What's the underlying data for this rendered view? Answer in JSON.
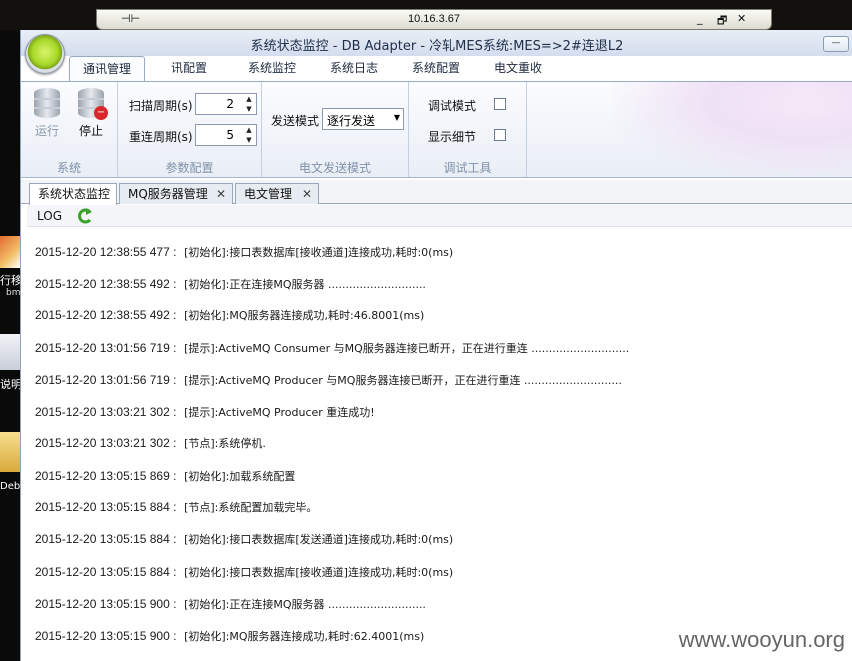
{
  "rdp": {
    "ip": "10.16.3.67",
    "pin_glyph": "⊣⊢",
    "minimize_glyph": "_",
    "restore_glyph": "🗗",
    "close_glyph": "✕"
  },
  "desktop": {
    "icon1_label": "行移",
    "icon1_sub": "bm",
    "icon2_label": "说明.",
    "icon3_label": "Deb"
  },
  "window": {
    "title": "系统状态监控 - DB Adapter - 冷轧MES系统:MES=>2#连退L2",
    "minimize_glyph": "—"
  },
  "ribbon_tabs": [
    "通讯管理",
    "讯配置",
    "系统监控",
    "系统日志",
    "系统配置",
    "电文重收"
  ],
  "ribbon": {
    "system": {
      "run_label": "运行",
      "stop_label": "停止",
      "group_label": "系统"
    },
    "params": {
      "scan_label": "扫描周期(s)",
      "scan_value": "2",
      "reconnect_label": "重连周期(s)",
      "reconnect_value": "5",
      "group_label": "参数配置"
    },
    "send": {
      "mode_label": "发送模式",
      "mode_value": "逐行发送",
      "group_label": "电文发送模式"
    },
    "debug": {
      "debug_mode_label": "调试模式",
      "show_detail_label": "显示细节",
      "group_label": "调试工具"
    }
  },
  "doc_tabs": [
    {
      "label": "系统状态监控"
    },
    {
      "label": "MQ服务器管理",
      "close": "✕"
    },
    {
      "label": "电文管理",
      "close": "✕"
    }
  ],
  "log": {
    "toolbar_label": "LOG",
    "lines": [
      {
        "ts": "2015-12-20 12:38:55 477 :",
        "msg": "[初始化]:接口表数据库[接收通道]连接成功,耗时:0(ms)"
      },
      {
        "ts": "2015-12-20 12:38:55 492 :",
        "msg": "[初始化]:正在连接MQ服务器 ............................"
      },
      {
        "ts": "2015-12-20 12:38:55 492 :",
        "msg": "[初始化]:MQ服务器连接成功,耗时:46.8001(ms)"
      },
      {
        "ts": "2015-12-20 13:01:56 719 :",
        "msg": "[提示]:ActiveMQ Consumer 与MQ服务器连接已断开，正在进行重连 ............................"
      },
      {
        "ts": "2015-12-20 13:01:56 719 :",
        "msg": "[提示]:ActiveMQ Producer 与MQ服务器连接已断开，正在进行重连 ............................"
      },
      {
        "ts": "2015-12-20 13:03:21 302 :",
        "msg": "[提示]:ActiveMQ Producer 重连成功!"
      },
      {
        "ts": "2015-12-20 13:03:21 302 :",
        "msg": "[节点]:系统停机."
      },
      {
        "ts": "2015-12-20 13:05:15 869 :",
        "msg": "[初始化]:加载系统配置"
      },
      {
        "ts": "2015-12-20 13:05:15 884 :",
        "msg": "[节点]:系统配置加载完毕。"
      },
      {
        "ts": "2015-12-20 13:05:15 884 :",
        "msg": "[初始化]:接口表数据库[发送通道]连接成功,耗时:0(ms)"
      },
      {
        "ts": "2015-12-20 13:05:15 884 :",
        "msg": "[初始化]:接口表数据库[接收通道]连接成功,耗时:0(ms)"
      },
      {
        "ts": "2015-12-20 13:05:15 900 :",
        "msg": "[初始化]:正在连接MQ服务器 ............................"
      },
      {
        "ts": "2015-12-20 13:05:15 900 :",
        "msg": "[初始化]:MQ服务器连接成功,耗时:62.4001(ms)"
      }
    ]
  },
  "watermark": "www.wooyun.org",
  "colors": {
    "orb": "#a8d82a",
    "stop_badge": "#d8282a",
    "refresh": "#3aa02a",
    "ribbon_border": "#99aac4"
  }
}
